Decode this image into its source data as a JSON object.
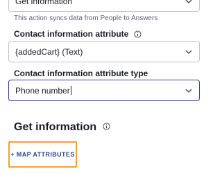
{
  "top_select": {
    "value": "Get information"
  },
  "helper_text": "This action syncs data from People to Answers",
  "contact_attr": {
    "label": "Contact information attribute",
    "value": "{addedCart} (Text)"
  },
  "contact_attr_type": {
    "label": "Contact information attribute type",
    "value": "Phone number"
  },
  "get_info": {
    "title": "Get information"
  },
  "map_button": {
    "label": "+ MAP ATTRIBUTES"
  },
  "colors": {
    "focus_border": "#2e3a8c",
    "button_highlight": "#f2a033",
    "button_text": "#2b4a8b"
  },
  "icons": [
    "chevron-down-icon",
    "info-icon"
  ]
}
